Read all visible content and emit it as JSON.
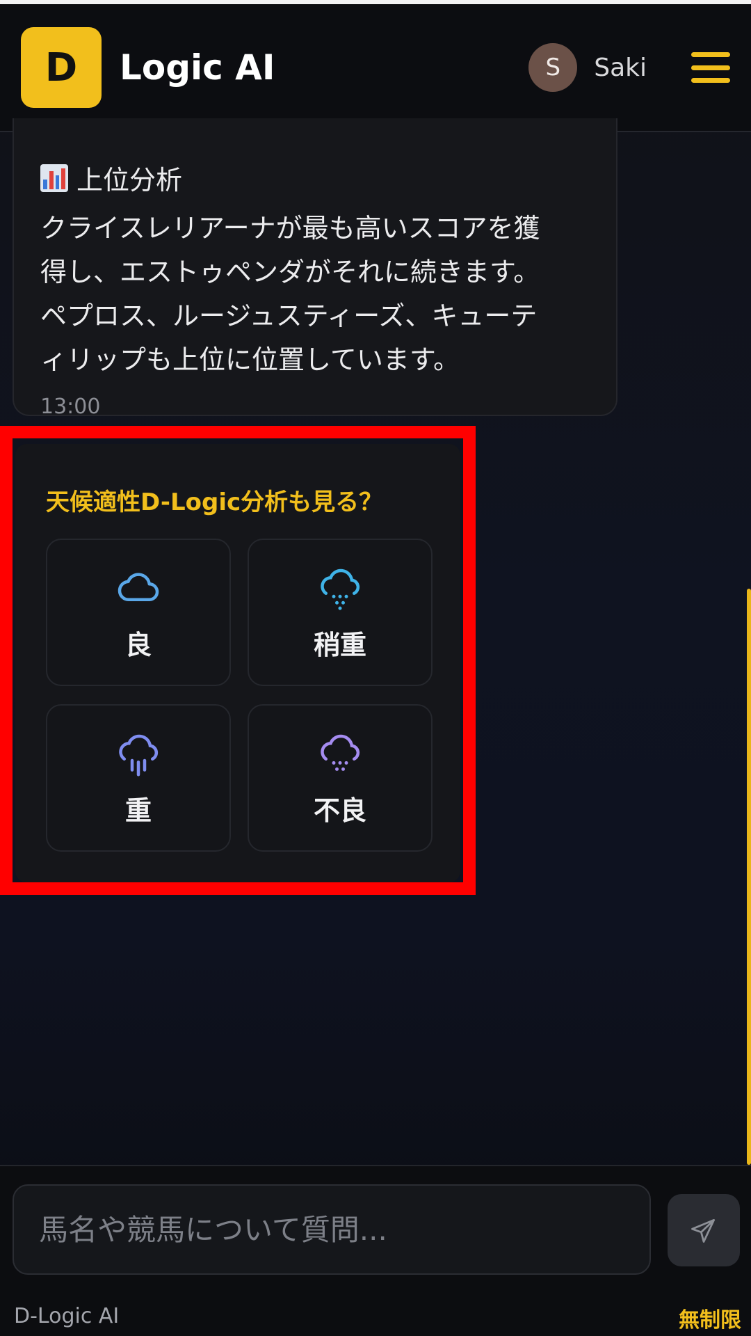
{
  "header": {
    "logo_letter": "D",
    "app_name": "Logic AI",
    "avatar_initial": "S",
    "user_name": "Saki"
  },
  "message": {
    "heading": "上位分析",
    "lines": [
      "クライスレリアーナが最も高いスコアを獲",
      "得し、エストゥペンダがそれに続きます。",
      "ペプロス、ルージュスティーズ、キューテ",
      "ィリップも上位に位置しています。"
    ],
    "time": "13:00"
  },
  "weather_prompt": {
    "title": "天候適性D-Logic分析も見る？",
    "options": [
      {
        "label": "良",
        "icon": "cloud-icon",
        "color": "#5aa7e8"
      },
      {
        "label": "稍重",
        "icon": "cloud-drizzle-icon",
        "color": "#3fb3e8"
      },
      {
        "label": "重",
        "icon": "cloud-rain-icon",
        "color": "#7f8df0"
      },
      {
        "label": "不良",
        "icon": "cloud-heavy-drizzle-icon",
        "color": "#a58cf0"
      }
    ]
  },
  "composer": {
    "placeholder": "馬名や競馬について質問...",
    "footer_brand": "D-Logic AI",
    "footer_plan": "無制限"
  },
  "colors": {
    "accent": "#f2bf1c",
    "highlight": "#ff0000",
    "background": "#0f1320"
  }
}
